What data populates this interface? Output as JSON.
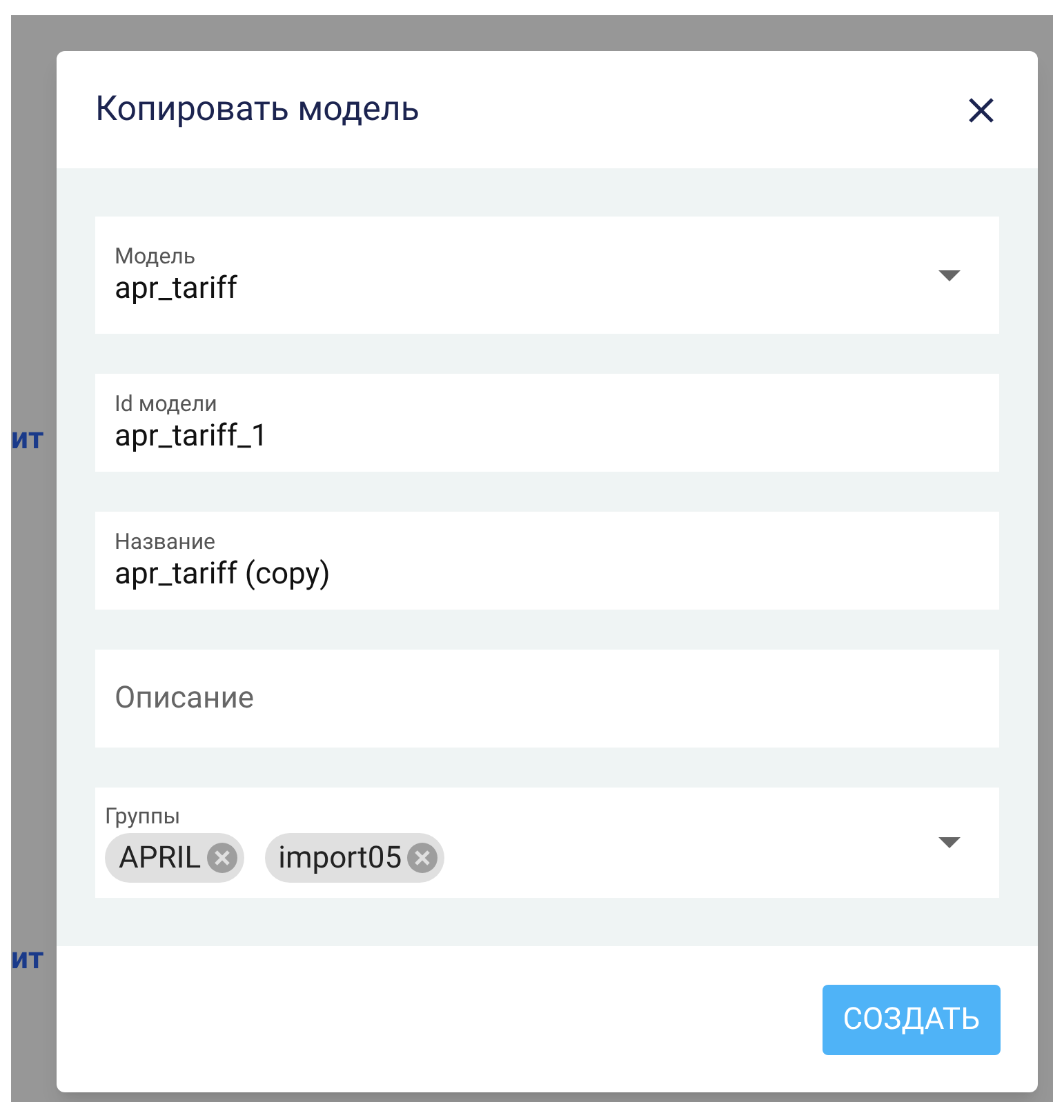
{
  "background": {
    "left_fragments": [
      "ит",
      "ит"
    ]
  },
  "dialog": {
    "title": "Копировать модель",
    "fields": [
      {
        "kind": "select",
        "label": "Модель",
        "value": "apr_tariff"
      },
      {
        "kind": "text",
        "label": "Id модели",
        "value": "apr_tariff_1"
      },
      {
        "kind": "text",
        "label": "Название",
        "value": "apr_tariff (copy)"
      },
      {
        "kind": "text",
        "placeholder": "Описание"
      },
      {
        "kind": "chips",
        "label": "Группы",
        "chips": [
          "APRIL",
          "import05"
        ]
      }
    ],
    "submit": "СОЗДАТЬ"
  }
}
